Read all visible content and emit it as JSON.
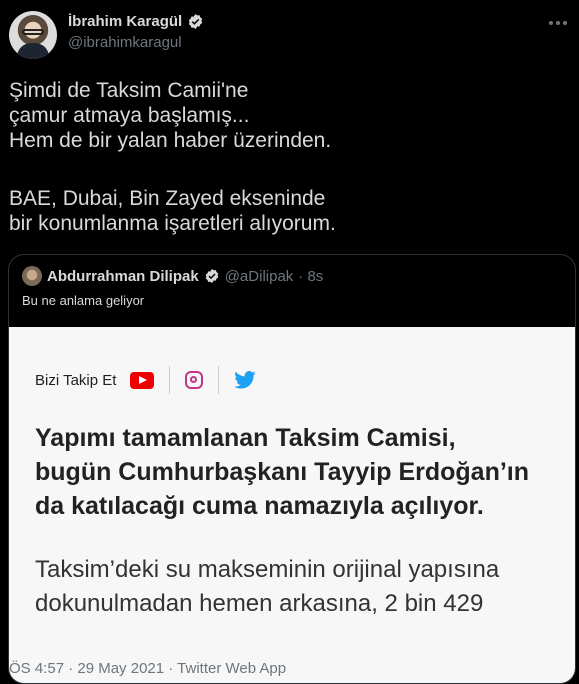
{
  "author": {
    "name": "İbrahim Karagül",
    "handle": "@ibrahimkaragul"
  },
  "tweet": {
    "lines": [
      "Şimdi de Taksim Camii'ne",
      "çamur atmaya başlamış...",
      "Hem de bir yalan haber üzerinden.",
      "",
      "BAE, Dubai, Bin Zayed ekseninde",
      "bir konumlanma işaretleri alıyorum."
    ]
  },
  "quote": {
    "name": "Abdurrahman Dilipak",
    "handle": "@aDilipak",
    "time": "· 8s",
    "text": "Bu ne anlama geliyor",
    "image": {
      "follow_label": "Bizi Takip Et",
      "headline": [
        "Yapımı tamamlanan Taksim Camisi,",
        "bugün Cumhurbaşkanı Tayyip Erdoğan’ın",
        "da katılacağı cuma namazıyla açılıyor."
      ],
      "body": [
        "Taksim’deki su makseminin orijinal yapısına",
        "dokunulmadan hemen arkasına, 2 bin 429"
      ]
    }
  },
  "footer": {
    "meta": "ÖS 4:57 · 29 May 2021 · Twitter Web App"
  },
  "colors": {
    "background": "#000000",
    "verified": "#1da1f2",
    "muted": "#6e767d"
  },
  "icons": [
    "verified-icon",
    "more-options-icon",
    "youtube-icon",
    "instagram-icon",
    "twitter-bird-icon"
  ]
}
